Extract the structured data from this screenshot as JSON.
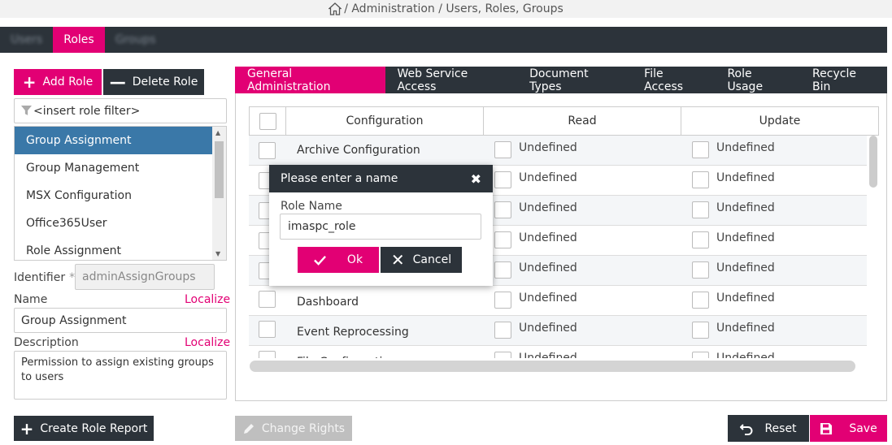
{
  "breadcrumb": {
    "path": "/ Administration / Users, Roles, Groups"
  },
  "topnav": {
    "tabs": [
      {
        "label": "Users"
      },
      {
        "label": "Roles"
      },
      {
        "label": "Groups"
      }
    ]
  },
  "left": {
    "add_role_label": "Add Role",
    "delete_role_label": "Delete Role",
    "filter_placeholder": "<insert role filter>",
    "roles": [
      {
        "label": "Group Assignment",
        "selected": true
      },
      {
        "label": "Group Management"
      },
      {
        "label": "MSX Configuration"
      },
      {
        "label": "Office365User"
      },
      {
        "label": "Role Assignment"
      }
    ],
    "identifier_label": "Identifier",
    "identifier_required": "*",
    "identifier_value": "adminAssignGroups",
    "name_label": "Name",
    "name_localize": "Localize",
    "name_value": "Group Assignment",
    "description_label": "Description",
    "description_localize": "Localize",
    "description_value": "Permission to assign existing groups to users",
    "create_report_label": "Create Role Report"
  },
  "right": {
    "tabs": [
      {
        "label": "General Administration"
      },
      {
        "label": "Web Service Access"
      },
      {
        "label": "Document Types"
      },
      {
        "label": "File Access"
      },
      {
        "label": "Role Usage"
      },
      {
        "label": "Recycle Bin"
      }
    ],
    "columns": {
      "configuration": "Configuration",
      "read": "Read",
      "update": "Update"
    },
    "rows": [
      {
        "config": "Archive Configuration",
        "read": "Undefined",
        "update": "Undefined"
      },
      {
        "config": "",
        "read": "Undefined",
        "update": "Undefined"
      },
      {
        "config": "",
        "read": "Undefined",
        "update": "Undefined"
      },
      {
        "config": "",
        "read": "Undefined",
        "update": "Undefined"
      },
      {
        "config": "",
        "read": "Undefined",
        "update": "Undefined"
      },
      {
        "config": "Dashboard",
        "read": "Undefined",
        "update": "Undefined"
      },
      {
        "config": "Event Reprocessing",
        "read": "Undefined",
        "update": "Undefined"
      },
      {
        "config": "File Configuration",
        "read": "Undefined",
        "update": "Undefined"
      }
    ],
    "change_rights_label": "Change Rights",
    "reset_label": "Reset",
    "save_label": "Save"
  },
  "modal": {
    "title": "Please enter a name",
    "close": "✖",
    "role_name_label": "Role Name",
    "role_name_value": "imaspc_role",
    "ok_label": "Ok",
    "cancel_label": "Cancel"
  },
  "colors": {
    "accent": "#e20074",
    "dark": "#2c333a",
    "selected": "#3a78a8"
  }
}
